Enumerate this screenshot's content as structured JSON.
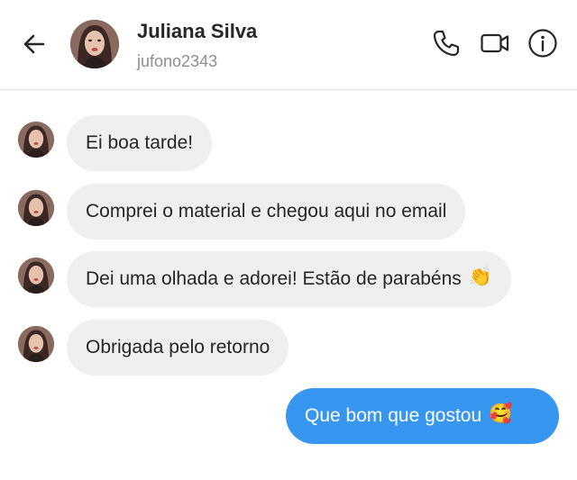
{
  "header": {
    "contact_name": "Juliana Silva",
    "contact_username": "jufono2343",
    "back_icon": "arrow-left-icon",
    "call_icon": "phone-icon",
    "video_icon": "video-camera-icon",
    "info_icon": "info-icon"
  },
  "messages": [
    {
      "direction": "incoming",
      "text": "Ei boa tarde!"
    },
    {
      "direction": "incoming",
      "text": "Comprei o material e chegou aqui no email"
    },
    {
      "direction": "incoming",
      "text": "Dei uma olhada e adorei! Estão de parabéns",
      "emoji": "👏"
    },
    {
      "direction": "incoming",
      "text": "Obrigada pelo retorno"
    },
    {
      "direction": "outgoing",
      "text": "Que bom que gostou",
      "emoji": "🥰"
    }
  ],
  "colors": {
    "outgoing_bubble": "#3797f0",
    "incoming_bubble": "#efefef",
    "text": "#262626",
    "secondary_text": "#8e8e8e"
  }
}
